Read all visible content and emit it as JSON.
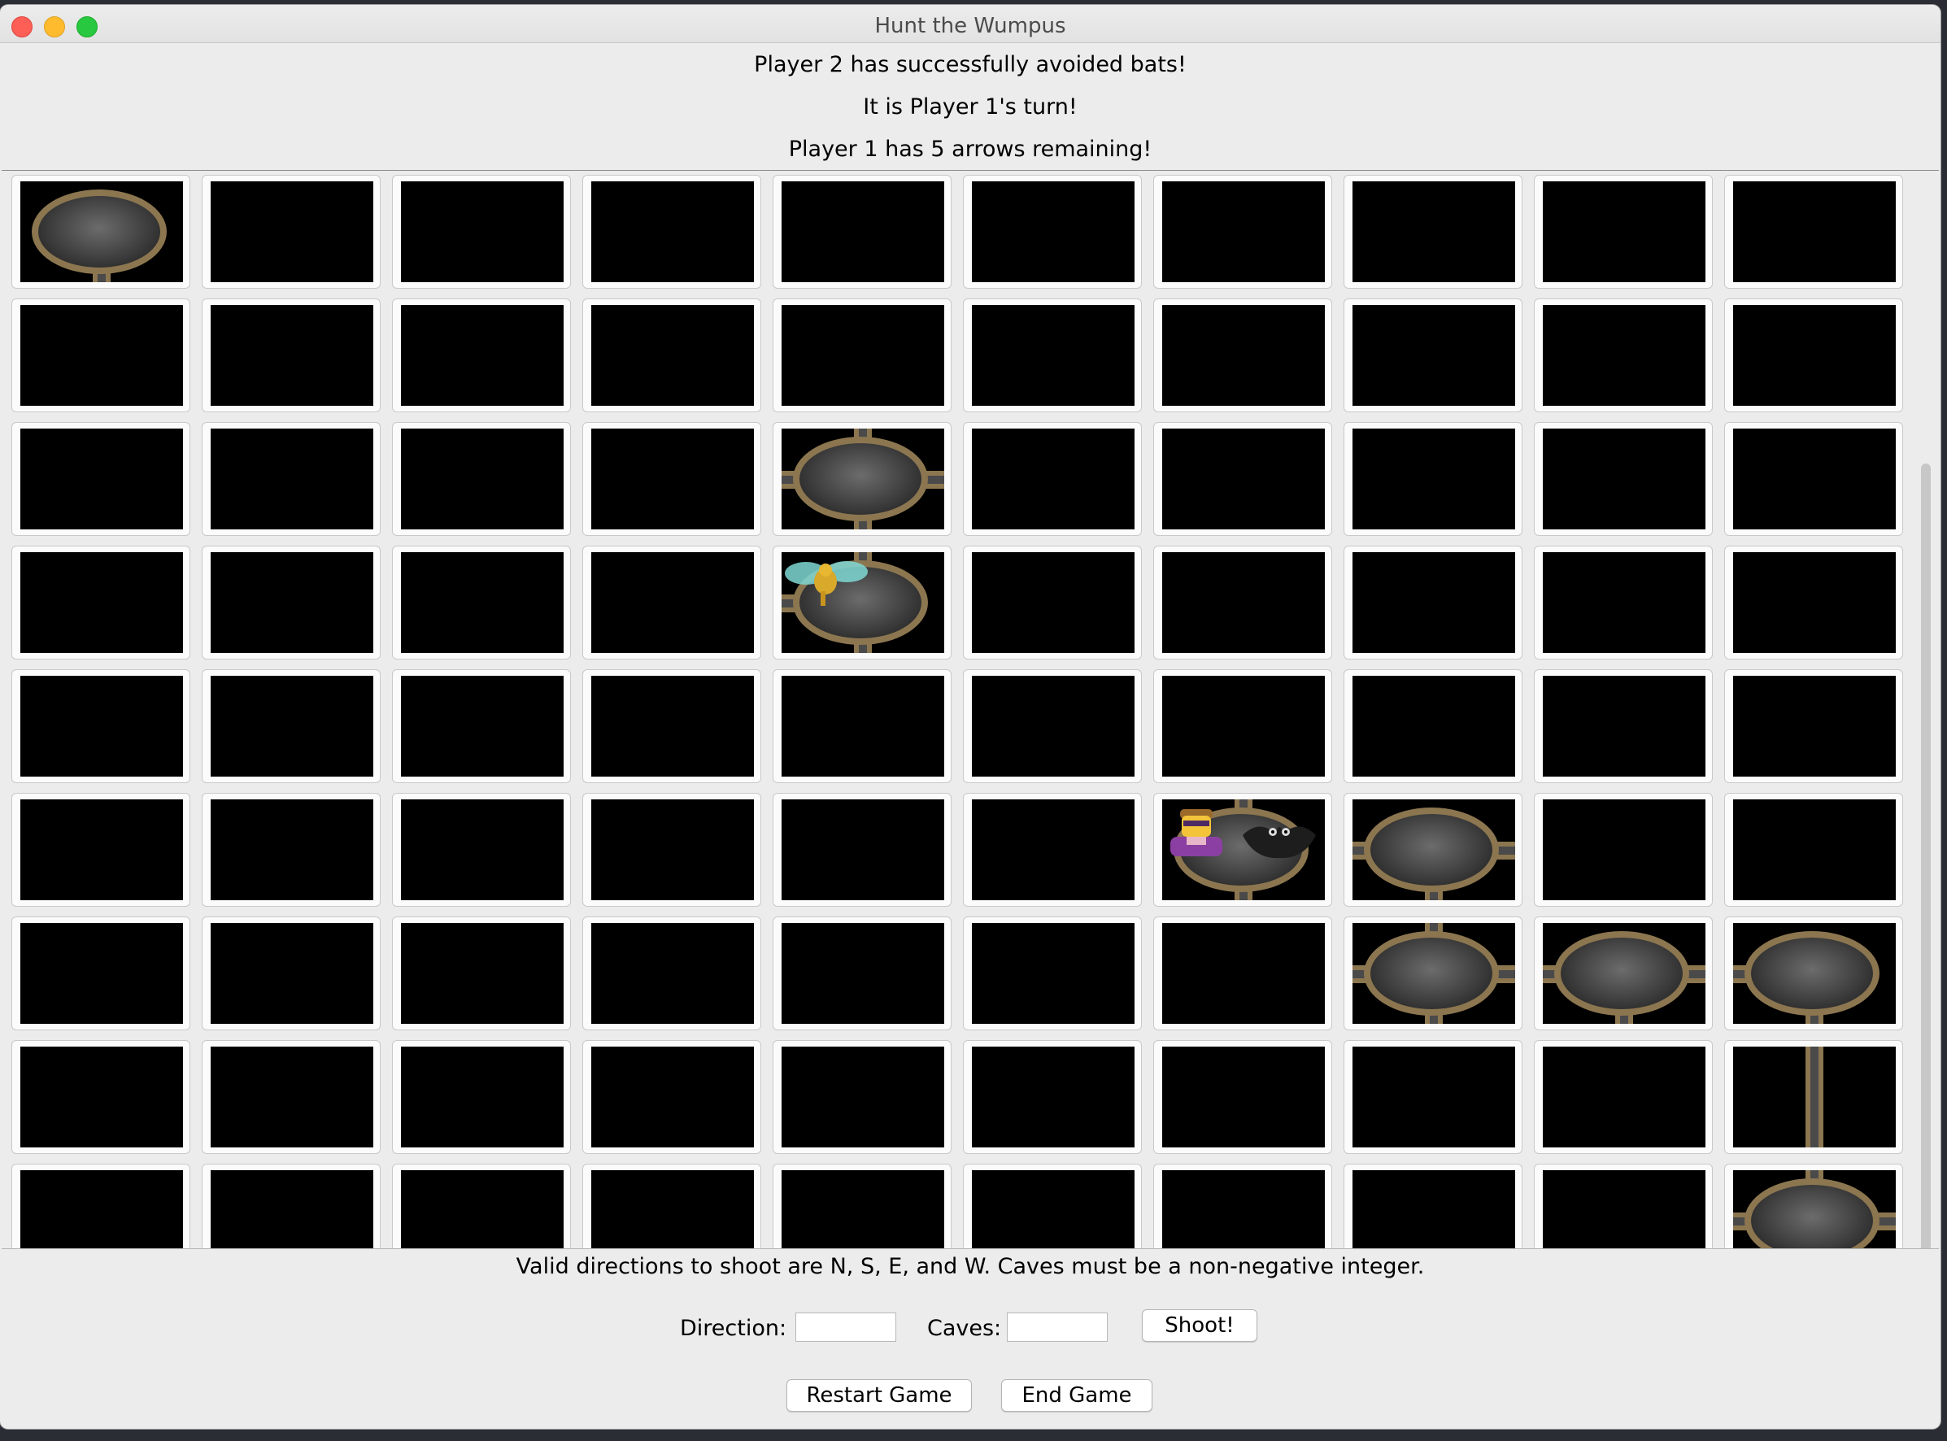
{
  "window": {
    "title": "Hunt the Wumpus"
  },
  "status": {
    "line1": "Player 2 has successfully avoided bats!",
    "line2": "It is Player 1's turn!",
    "line3": "Player 1 has 5 arrows remaining!"
  },
  "board": {
    "rows": 9,
    "cols": 10,
    "visible_caves": [
      {
        "row": 0,
        "col": 0,
        "exits": [
          "S"
        ]
      },
      {
        "row": 2,
        "col": 4,
        "exits": [
          "N",
          "S",
          "E",
          "W"
        ]
      },
      {
        "row": 3,
        "col": 4,
        "exits": [
          "N",
          "S",
          "W"
        ],
        "occupant": "bat"
      },
      {
        "row": 5,
        "col": 6,
        "exits": [
          "N",
          "S"
        ],
        "occupant": "player"
      },
      {
        "row": 5,
        "col": 7,
        "exits": [
          "S",
          "E",
          "W"
        ]
      },
      {
        "row": 6,
        "col": 7,
        "exits": [
          "N",
          "S",
          "E",
          "W"
        ]
      },
      {
        "row": 6,
        "col": 8,
        "exits": [
          "S",
          "E",
          "W"
        ]
      },
      {
        "row": 6,
        "col": 9,
        "exits": [
          "S",
          "W"
        ]
      },
      {
        "row": 7,
        "col": 9,
        "exits": [
          "N",
          "S"
        ],
        "tunnel": true
      },
      {
        "row": 8,
        "col": 9,
        "exits": [
          "N",
          "E",
          "W"
        ]
      }
    ]
  },
  "controls": {
    "hint": "Valid directions to shoot are N, S, E, and W. Caves must be a non-negative integer.",
    "direction_label": "Direction:",
    "direction_value": "",
    "caves_label": "Caves:",
    "caves_value": "",
    "shoot_label": "Shoot!",
    "restart_label": "Restart Game",
    "end_label": "End Game"
  },
  "colors": {
    "wall": "#8c7650",
    "tile_black": "#000000",
    "window_bg": "#ececec"
  }
}
